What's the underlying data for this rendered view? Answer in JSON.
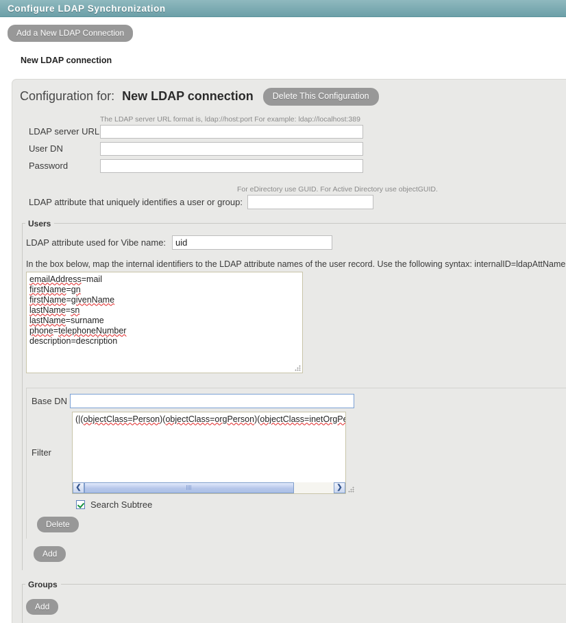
{
  "window": {
    "title": "Configure LDAP Synchronization",
    "accent_color": "#7fadb4"
  },
  "toolbar": {
    "add_connection_label": "Add a New LDAP Connection"
  },
  "connection_heading": "New LDAP connection",
  "config": {
    "title_prefix": "Configuration for:",
    "title_name": "New LDAP connection",
    "delete_config_label": "Delete This Configuration",
    "url_hint": "The LDAP server URL format is, ldap://host:port   For example: ldap://localhost:389",
    "fields": [
      {
        "label": "LDAP server URL",
        "value": ""
      },
      {
        "label": "User DN",
        "value": ""
      },
      {
        "label": "Password",
        "value": ""
      }
    ],
    "guid_hint": "For eDirectory use GUID. For Active Directory use objectGUID.",
    "unique_attr_label": "LDAP attribute that uniquely identifies a user or group:",
    "unique_attr_value": ""
  },
  "users": {
    "legend": "Users",
    "vibe_name_label": "LDAP attribute used for Vibe name:",
    "vibe_name_value": "uid",
    "map_instructions": "In the box below, map the internal identifiers to the LDAP attribute names of the user record. Use the following syntax: internalID=ldapAttName",
    "attribute_map": "emailAddress=mail\nfirstName=gn\nfirstName=givenName\nlastName=sn\nlastName=surname\nphone=telephoneNumber\ndescription=description",
    "attribute_map_lines": [
      "emailAddress=mail",
      "firstName=gn",
      "firstName=givenName",
      "lastName=sn",
      "lastName=surname",
      "phone=telephoneNumber",
      "description=description"
    ],
    "base_dn_label": "Base DN",
    "base_dn_value": "",
    "filter_label": "Filter",
    "filter_value": "(|(objectClass=Person)(objectClass=orgPerson)(objectClass=inetOrgPerson))",
    "filter_visible_text": "(|(objectClass=Person)(objectClass=orgPerson)(objectClass=inetOrgPe",
    "search_subtree_label": "Search Subtree",
    "search_subtree_checked": true,
    "delete_label": "Delete",
    "add_label": "Add",
    "scroll_left_icon": "❮",
    "scroll_right_icon": "❯"
  },
  "groups": {
    "legend": "Groups",
    "add_label": "Add"
  }
}
